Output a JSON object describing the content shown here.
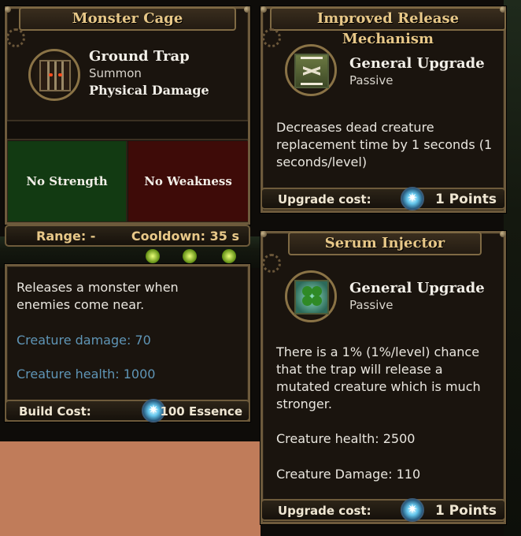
{
  "monster_cage": {
    "title": "Monster Cage",
    "trap_name": "Ground Trap",
    "trap_type": "Summon",
    "damage_type": "Physical Damage",
    "strength_label": "No Strength",
    "weakness_label": "No Weakness",
    "range_label": "Range: -",
    "cooldown_label": "Cooldown: 35 s",
    "description": "Releases a monster when enemies come near.",
    "creature_damage": "Creature damage: 70",
    "creature_health": "Creature health: 1000",
    "build_cost_label": "Build Cost:",
    "build_cost_value": "100 Essence",
    "icon": "cage-icon"
  },
  "improved_release": {
    "title": "Improved Release Mechanism",
    "upgrade_name": "General Upgrade",
    "upgrade_type": "Passive",
    "description": "Decreases dead creature replacement time by 1 seconds (1 seconds/level)",
    "cost_label": "Upgrade cost:",
    "cost_value": "1 Points",
    "icon": "hourglass-icon"
  },
  "serum_injector": {
    "title": "Serum Injector",
    "upgrade_name": "General Upgrade",
    "upgrade_type": "Passive",
    "description": "There is a 1% (1%/level) chance that the trap will release a mutated creature which is much stronger.",
    "creature_health": "Creature health: 2500",
    "creature_damage": "Creature Damage: 110",
    "cost_label": "Upgrade cost:",
    "cost_value": "1 Points",
    "icon": "clover-icon"
  },
  "colors": {
    "title_gold": "#e8c888",
    "stat_blue": "#5f95b6",
    "strength_green": "#123a12",
    "weakness_red": "#3e0b08"
  }
}
